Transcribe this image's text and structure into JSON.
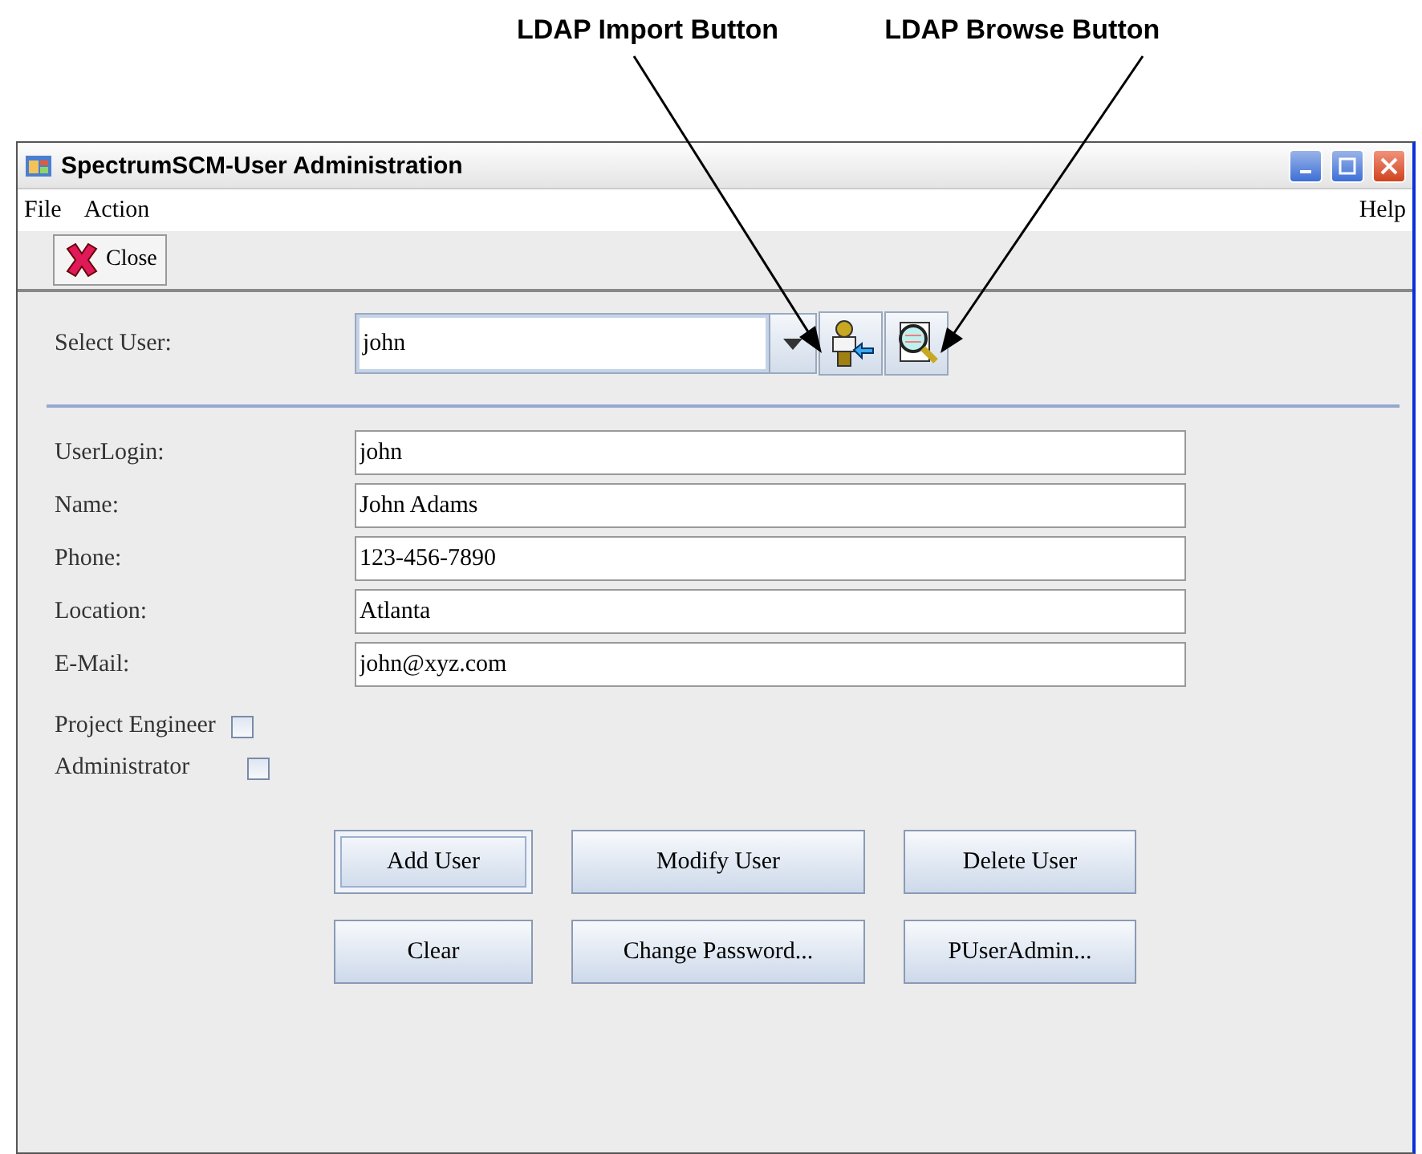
{
  "callouts": [
    {
      "label": "LDAP Import Button"
    },
    {
      "label": "LDAP Browse Button"
    }
  ],
  "window": {
    "title": "SpectrumSCM-User Administration"
  },
  "menu": {
    "left": [
      "File",
      "Action"
    ],
    "right": [
      "Help"
    ]
  },
  "toolbar": {
    "close_label": "Close"
  },
  "select_user": {
    "label": "Select User:",
    "value": "john"
  },
  "fields": [
    {
      "label": "UserLogin:",
      "value": "john"
    },
    {
      "label": "Name:",
      "value": "John Adams"
    },
    {
      "label": "Phone:",
      "value": "123-456-7890"
    },
    {
      "label": "Location:",
      "value": "Atlanta"
    },
    {
      "label": "E-Mail:",
      "value": "john@xyz.com"
    }
  ],
  "checkboxes": [
    {
      "label": "Project Engineer",
      "checked": false
    },
    {
      "label": "Administrator",
      "checked": false
    }
  ],
  "buttons": [
    [
      {
        "label": "Add User",
        "focused": true
      },
      {
        "label": "Modify User",
        "focused": false
      },
      {
        "label": "Delete User",
        "focused": false
      }
    ],
    [
      {
        "label": "Clear",
        "focused": false
      },
      {
        "label": "Change Password...",
        "focused": false
      },
      {
        "label": "PUserAdmin...",
        "focused": false
      }
    ]
  ]
}
